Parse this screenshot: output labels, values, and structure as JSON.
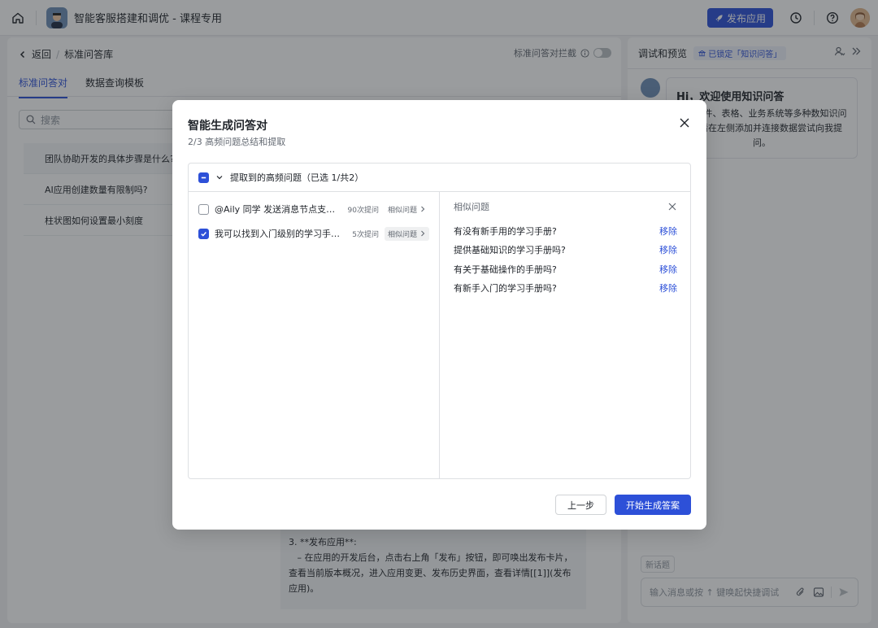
{
  "topbar": {
    "app_title": "智能客服搭建和调优 - 课程专用",
    "publish_label": "发布应用"
  },
  "left_panel": {
    "back_label": "返回",
    "breadcrumb_current": "标准问答库",
    "toggle_label": "标准问答对拦截",
    "tabs": [
      {
        "label": "标准问答对"
      },
      {
        "label": "数据查询模板"
      }
    ],
    "search_placeholder": "搜索",
    "questions": [
      {
        "text": "团队协助开发的具体步骤是什么?"
      },
      {
        "text": "AI应用创建数量有限制吗?"
      },
      {
        "text": "柱状图如何设置最小刻度"
      }
    ],
    "answer_lines": [
      "3. **发布应用**:",
      "   – 在应用的开发后台，点击右上角「发布」按钮，即可唤出发布卡片，查看当前版本概况，进入应用变更、发布历史界面，查看详情[[1]](发布应用)。"
    ]
  },
  "right_panel": {
    "title": "调试和预览",
    "lock_badge": "已锁定「知识问答」",
    "welcome_title": "Hi，欢迎使用知识问答",
    "welcome_body": "进行文件、表格、业务系统等多种数知识问答。请在左侧添加并连接数据尝试向我提问。",
    "new_topic": "新话题",
    "input_placeholder": "输入消息或按 ↑ 键唤起快捷调试"
  },
  "modal": {
    "title": "智能生成问答对",
    "subtitle": "2/3 高频问题总结和提取",
    "group_header": "提取到的高频问题（已选 1/共2）",
    "questions": [
      {
        "text": "@Aily 同学 发送消息节点支持 markdown 吗?",
        "count": "90次提问",
        "similar": "相似问题",
        "checked": false
      },
      {
        "text": "我可以找到入门级别的学习手册吗?",
        "count": "5次提问",
        "similar": "相似问题",
        "checked": true
      }
    ],
    "similar_title": "相似问题",
    "similar_items": [
      {
        "text": "有没有新手用的学习手册?",
        "action": "移除"
      },
      {
        "text": "提供基础知识的学习手册吗?",
        "action": "移除"
      },
      {
        "text": "有关于基础操作的手册吗?",
        "action": "移除"
      },
      {
        "text": "有新手入门的学习手册吗?",
        "action": "移除"
      }
    ],
    "prev_label": "上一步",
    "next_label": "开始生成答案"
  },
  "colors": {
    "accent": "#2d50d8",
    "overlay": "rgba(31,35,41,0.45)"
  }
}
